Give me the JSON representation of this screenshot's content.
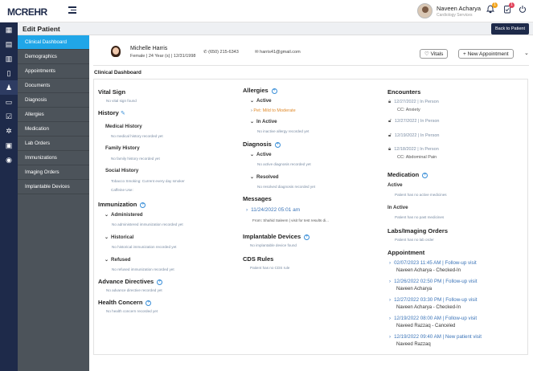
{
  "header": {
    "logo": "MCREHR",
    "user_name": "Naveen Acharya",
    "user_role": "Cardiology Services",
    "notif_count": "1",
    "task_count": "1"
  },
  "subheader": {
    "title": "Edit Patient",
    "back_label": "Back to Patient"
  },
  "nav": [
    "Clinical Dashboard",
    "Demographics",
    "Appointments",
    "Documents",
    "Diagnosis",
    "Allergies",
    "Medication",
    "Lab Orders",
    "Immunizations",
    "Imaging Orders",
    "Implantable Devices"
  ],
  "patient": {
    "name": "Michelle Harris",
    "info": "Female | 24 Year (s) | 12/31/1998",
    "phone": "(650) 215-6343",
    "email": "harris41@gmail.com",
    "vitals_label": "Vitals",
    "new_appt_label": "New Appointment"
  },
  "dashboard_title": "Clinical Dashboard",
  "col1": {
    "vital_sign": "Vital Sign",
    "vital_none": "No vital sign found",
    "history": "History",
    "medical_history": "Medical History",
    "medical_none": "No medical history recorded yet",
    "family_history": "Family History",
    "family_none": "No family history recorded yet",
    "social_history": "Social History",
    "social_1": "Tobacco Smoking: Current every day smoker",
    "social_2": "Caffeine Use:",
    "immunization": "Immunization",
    "administered": "Administered",
    "administered_none": "No administered immunization recorded yet",
    "historical": "Historical",
    "historical_none": "No historical immunization recorded yet",
    "refused": "Refused",
    "refused_none": "No refused immunization recorded yet",
    "advance": "Advance Directives",
    "advance_none": "No advance directive recorded yet",
    "health": "Health Concern",
    "health_none": "No health concern recorded yet"
  },
  "col2": {
    "allergies": "Allergies",
    "active": "Active",
    "allergy_item": "Pet: Mild to Moderate",
    "inactive": "In Active",
    "inactive_none": "No inactive allergy recorded yet",
    "diagnosis": "Diagnosis",
    "dx_active": "Active",
    "dx_active_none": "No active diagnosis recorded yet",
    "dx_resolved": "Resolved",
    "dx_resolved_none": "No resolved diagnosis recorded yet",
    "messages": "Messages",
    "msg_date": "11/24/2022 05:01 am",
    "msg_text": "From: Shahid Saleem | visit for test results di...",
    "implantable": "Implantable Devices",
    "implantable_none": "No implantable device found",
    "cds": "CDS Rules",
    "cds_none": "Patient has no CDS rule"
  },
  "col3": {
    "encounters": "Encounters",
    "enc": [
      {
        "text": "12/27/2022 | In Person",
        "sub": "CC: Anxiety"
      },
      {
        "text": "12/27/2022 | In Person",
        "sub": ""
      },
      {
        "text": "12/19/2022 | In Person",
        "sub": ""
      },
      {
        "text": "12/18/2022 | In Person",
        "sub": "CC: Abdominal Pain"
      }
    ],
    "medication": "Medication",
    "med_active": "Active",
    "med_active_none": "Patient has no active medicines",
    "med_inactive": "In Active",
    "med_inactive_none": "Patient has no past medicines",
    "labs": "Labs/Imaging Orders",
    "labs_none": "Patient has no lab order",
    "appointment": "Appointment",
    "appts": [
      {
        "when": "02/07/2023 11:45 AM | Follow-up visit",
        "who": "Naveen Acharya - Checked-In"
      },
      {
        "when": "12/26/2022 02:50 PM | Follow-up visit",
        "who": "Naveen Acharya"
      },
      {
        "when": "12/27/2022 03:30 PM | Follow-up visit",
        "who": "Naveen Acharya - Checked-In"
      },
      {
        "when": "12/19/2022 08:00 AM | Follow-up visit",
        "who": "Naveed Razzaq - Canceled"
      },
      {
        "when": "12/19/2022 09:40 AM | New patient visit",
        "who": "Naveed Razzaq"
      }
    ]
  }
}
